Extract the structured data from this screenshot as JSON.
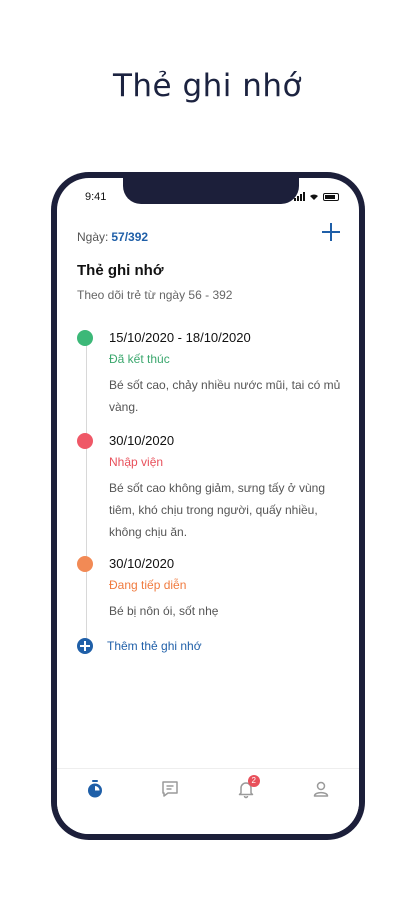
{
  "page_title": "Thẻ ghi nhớ",
  "status_bar": {
    "time": "9:41"
  },
  "header": {
    "day_label": "Ngày:",
    "day_value": "57/392",
    "title": "Thẻ ghi nhớ",
    "subtitle": "Theo dõi trẻ từ ngày 56 - 392"
  },
  "entries": [
    {
      "date": "15/10/2020 - 18/10/2020",
      "status": "Đã kết thúc",
      "status_color": "#3aa76d",
      "dot_color": "#3cb878",
      "description": "Bé sốt cao, chảy nhiều nước mũi, tai có mủ vàng."
    },
    {
      "date": "30/10/2020",
      "status": "Nhập viện",
      "status_color": "#e8505b",
      "dot_color": "#ef5867",
      "description": "Bé sốt cao không giảm, sưng tấy ở vùng tiêm, khó chịu trong người, quấy nhiều, không chịu ăn."
    },
    {
      "date": "30/10/2020",
      "status": "Đang tiếp diễn",
      "status_color": "#f07a3e",
      "dot_color": "#f28a55",
      "description": "Bé bị nôn ói, sốt nhẹ"
    }
  ],
  "add_memo_label": "Thêm thẻ ghi nhớ",
  "tabbar": {
    "tabs": [
      "timer-icon",
      "note-icon",
      "bell-icon",
      "user-icon"
    ],
    "notification_count": "2",
    "active_color": "#1f5fa8",
    "inactive_color": "#9a9a9a"
  }
}
